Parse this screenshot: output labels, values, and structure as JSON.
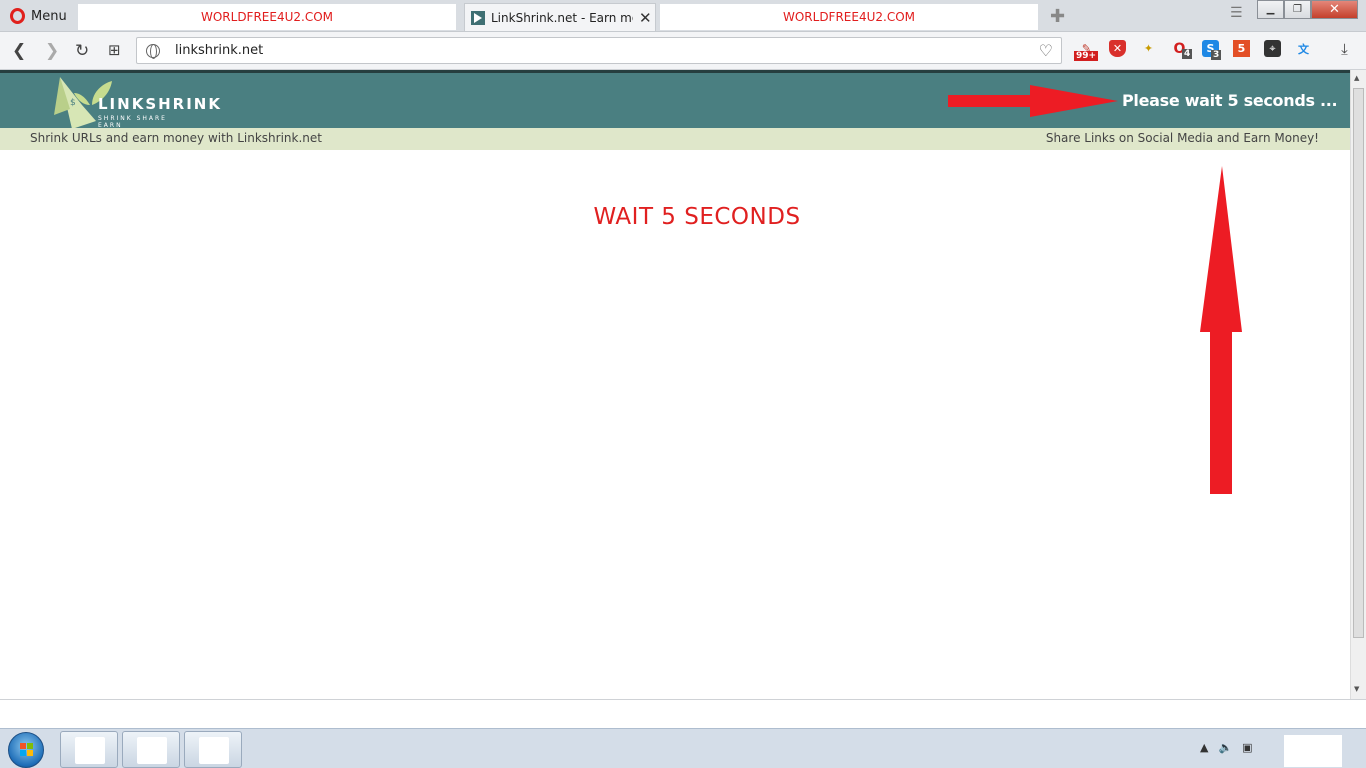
{
  "browser": {
    "menu_label": "Menu",
    "tabs": [
      {
        "label": "WORLDFREE4U2.COM"
      },
      {
        "label": "LinkShrink.net - Earn money"
      },
      {
        "label": "WORLDFREE4U2.COM"
      }
    ],
    "url": "linkshrink.net",
    "extension_badges": {
      "badge1": "99+",
      "badge2": "4",
      "badge3": "3"
    }
  },
  "site": {
    "logo_main": "LINKSHRINK",
    "logo_tagline": "SHRINK SHARE EARN",
    "header_wait": "Please wait 5 seconds ...",
    "subbar_left": "Shrink URLs and earn money with Linkshrink.net",
    "subbar_right": "Share Links on Social Media and Earn Money!",
    "wait_message": "WAIT 5 SECONDS"
  },
  "colors": {
    "header_bg": "#4a7f81",
    "subbar_bg": "#dfe7ca",
    "accent_red": "#e02020",
    "annotation_arrow": "#ed1c24"
  }
}
